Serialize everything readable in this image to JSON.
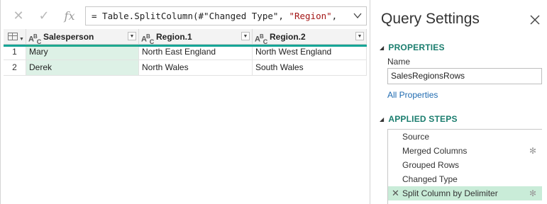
{
  "formula_bar": {
    "cancel_icon": "✕",
    "commit_icon": "✓",
    "fx_label": "fx",
    "formula_prefix": "= Table.SplitColumn(#\"Changed Type\", ",
    "formula_string": "\"Region\"",
    "formula_suffix": ",",
    "expand_icon": "chevron-down-icon"
  },
  "grid": {
    "columns": [
      {
        "name": "Salesperson",
        "type_icon": "ABC"
      },
      {
        "name": "Region.1",
        "type_icon": "ABC"
      },
      {
        "name": "Region.2",
        "type_icon": "ABC"
      }
    ],
    "rows": [
      {
        "num": "1",
        "cells": [
          "Mary",
          "North East England",
          "North West England"
        ]
      },
      {
        "num": "2",
        "cells": [
          "Derek",
          "North Wales",
          "South Wales"
        ]
      }
    ],
    "accent_color": "#16a596",
    "selected_fill": "#ddf1e6"
  },
  "query_settings": {
    "title": "Query Settings",
    "close_icon": "✕",
    "properties_heading": "PROPERTIES",
    "name_label": "Name",
    "name_value": "SalesRegionsRows",
    "all_properties_link": "All Properties",
    "applied_steps_heading": "APPLIED STEPS",
    "steps": [
      {
        "label": "Source",
        "has_gear": false,
        "active": false
      },
      {
        "label": "Merged Columns",
        "has_gear": true,
        "active": false
      },
      {
        "label": "Grouped Rows",
        "has_gear": false,
        "active": false
      },
      {
        "label": "Changed Type",
        "has_gear": false,
        "active": false
      },
      {
        "label": "Split Column by Delimiter",
        "has_gear": true,
        "active": true
      }
    ],
    "heading_color": "#1a7d6e",
    "link_color": "#1e6ab0"
  }
}
